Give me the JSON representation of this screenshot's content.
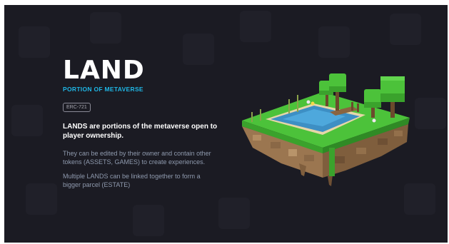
{
  "slide": {
    "title": "LAND",
    "subtitle": "PORTION OF METAVERSE",
    "badge": "ERC-721",
    "headline": "LANDS are portions of the metaverse open to player ownership.",
    "paragraph_1": "They can be edited by their owner and contain other tokens (ASSETS, GAMES) to create experiences.",
    "paragraph_2": "Multiple LANDS can be linked together to form a bigger parcel (ESTATE)"
  },
  "colors": {
    "background": "#1b1b23",
    "title": "#ffffff",
    "accent": "#1fb7e6",
    "body_text": "#8f9aae",
    "grass": "#4cc23a",
    "water": "#3d8fc4",
    "dirt": "#a98358"
  },
  "illustration": {
    "icon": "voxel-land-island-icon"
  }
}
